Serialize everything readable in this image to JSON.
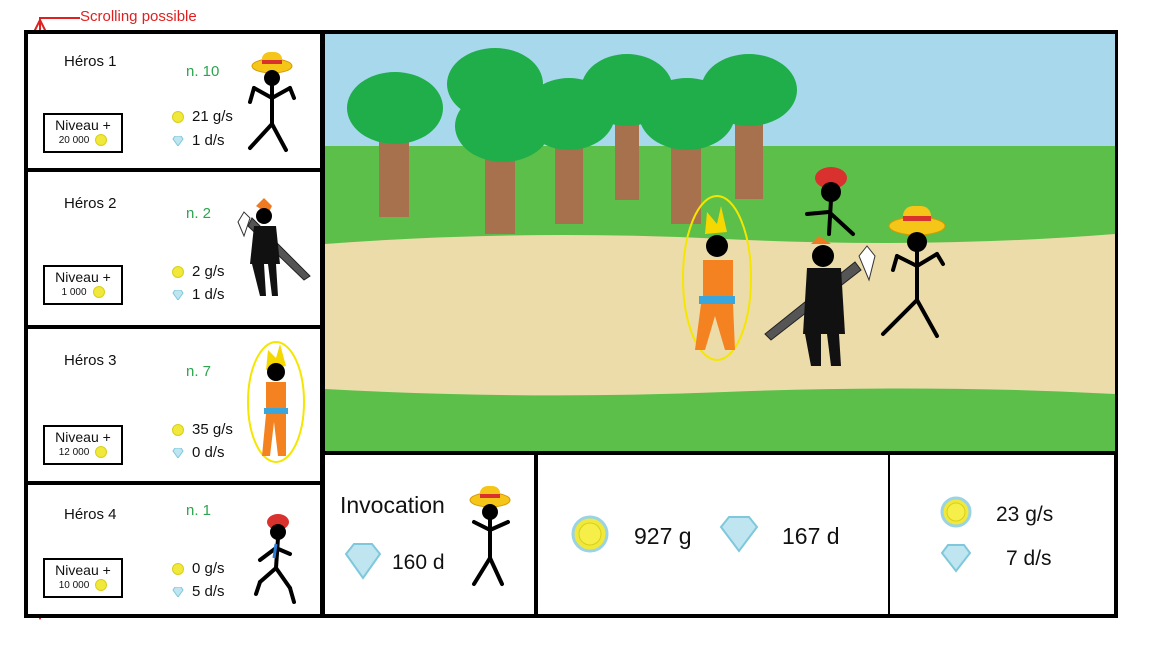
{
  "scroll_hint": "Scrolling possible",
  "heroes": [
    {
      "name": "Héros 1",
      "count": "n. 10",
      "gold_rate": "21 g/s",
      "gem_rate": "1 d/s",
      "level_label": "Niveau +",
      "level_cost": "20 000"
    },
    {
      "name": "Héros 2",
      "count": "n. 2",
      "gold_rate": "2 g/s",
      "gem_rate": "1 d/s",
      "level_label": "Niveau +",
      "level_cost": "1 000"
    },
    {
      "name": "Héros 3",
      "count": "n. 7",
      "gold_rate": "35 g/s",
      "gem_rate": "0 d/s",
      "level_label": "Niveau +",
      "level_cost": "12 000"
    },
    {
      "name": "Héros 4",
      "count": "n. 1",
      "gold_rate": "0 g/s",
      "gem_rate": "5 d/s",
      "level_label": "Niveau +",
      "level_cost": "10 000"
    }
  ],
  "summon": {
    "label": "Invocation",
    "cost": "160 d"
  },
  "totals": {
    "gold": "927 g",
    "gems": "167 d"
  },
  "income": {
    "gold": "23 g/s",
    "gems": "7 d/s"
  },
  "colors": {
    "accent_green": "#2ea44f",
    "scroll_red": "#e02020",
    "sky": "#a8d8ec",
    "grass": "#5cbf4a",
    "path": "#ecdcaa",
    "tree_leaf": "#1fae4a",
    "trunk": "#a8714e",
    "coin": "#f0e83a"
  }
}
